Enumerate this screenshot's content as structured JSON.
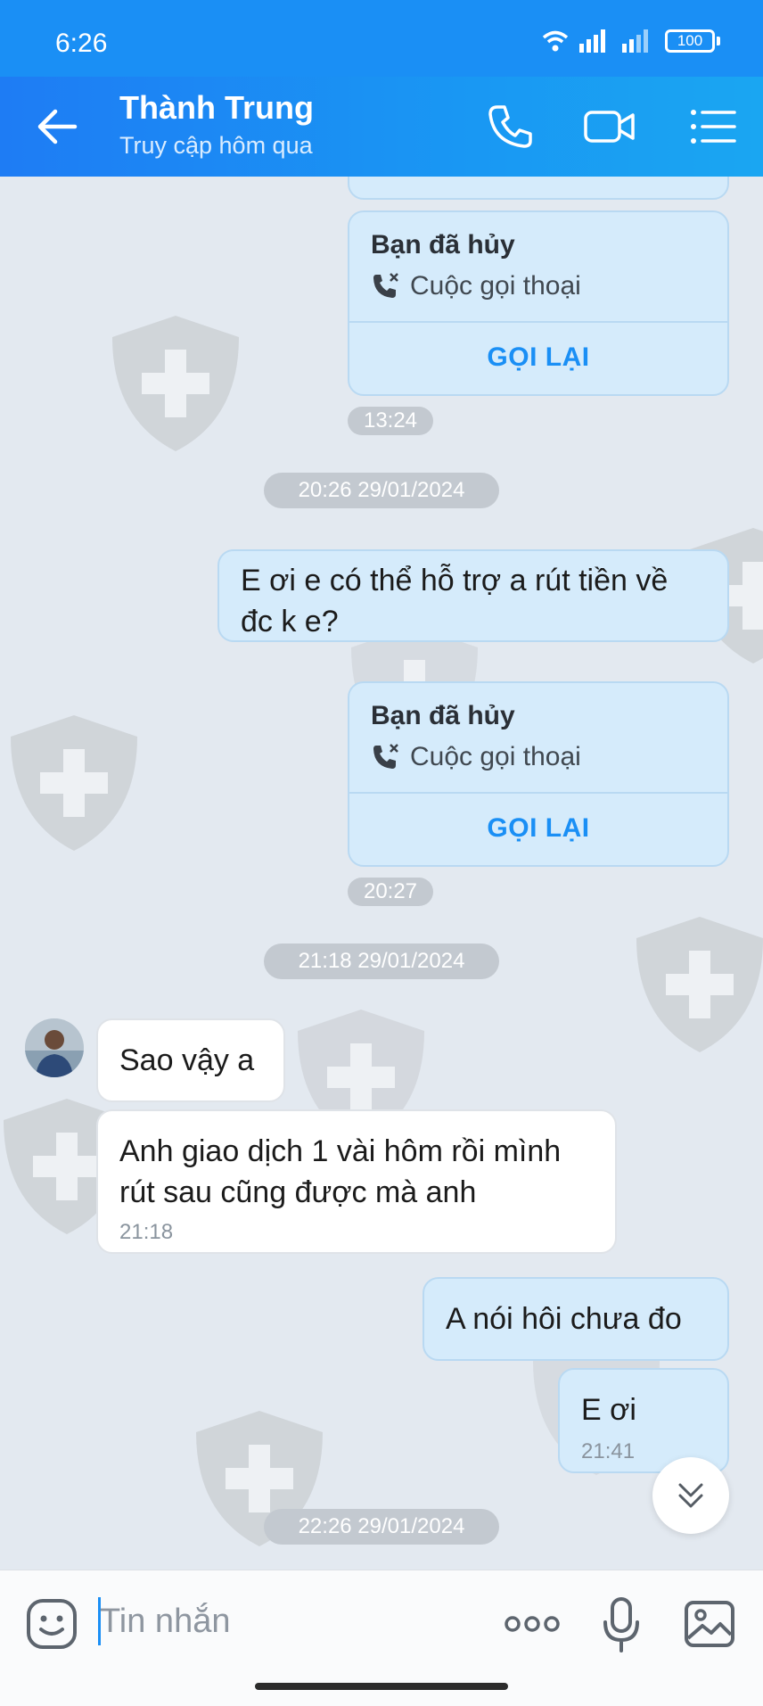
{
  "status_bar": {
    "time": "6:26",
    "battery": "100"
  },
  "header": {
    "back_icon": "arrow-left-icon",
    "contact_name": "Thành Trung",
    "contact_status": "Truy cập hôm qua",
    "actions": [
      "phone-icon",
      "video-call-icon",
      "menu-list-icon"
    ]
  },
  "messages": {
    "call1": {
      "title": "Bạn đã hủy",
      "subtitle": "Cuộc gọi thoại",
      "action": "GỌI LẠI",
      "time": "13:24"
    },
    "date1": "20:26 29/01/2024",
    "out1": {
      "text": "E ơi e có thể hỗ trợ a rút tiền về đc k e?"
    },
    "call2": {
      "title": "Bạn đã hủy",
      "subtitle": "Cuộc gọi thoại",
      "action": "GỌI LẠI",
      "time": "20:27"
    },
    "date2": "21:18 29/01/2024",
    "in1": {
      "text": "Sao vậy a"
    },
    "in2": {
      "text": "Anh giao dịch 1 vài hôm rồi mình rút sau cũng được mà anh",
      "time": "21:18"
    },
    "out2": {
      "text": "A nói hôi chưa đo"
    },
    "out3": {
      "text": "E ơi",
      "time": "21:41"
    },
    "date3": "22:26 29/01/2024"
  },
  "composer": {
    "placeholder": "Tin nhắn",
    "icons": [
      "emoji-icon",
      "more-options-icon",
      "microphone-icon",
      "image-icon"
    ]
  },
  "colors": {
    "accent": "#1a8ff5",
    "outgoing_bubble": "#d5ebfb",
    "incoming_bubble": "#ffffff",
    "chat_bg": "#e3e9f0"
  }
}
